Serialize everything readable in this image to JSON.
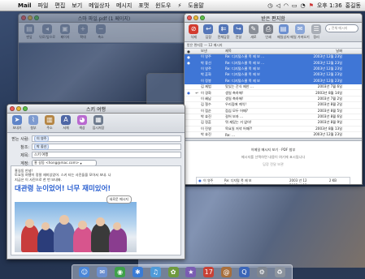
{
  "menubar": {
    "app_name": "Mail",
    "items": [
      "파일",
      "편집",
      "보기",
      "메일상자",
      "메시지",
      "포맷",
      "윈도우",
      "도움말"
    ],
    "status_icons": [
      "sync-icon",
      "volume-icon",
      "airport-icon",
      "battery-icon",
      "timer-icon",
      "flag-icon"
    ],
    "clock": "오후 1:36",
    "user": "홍길동"
  },
  "back_window": {
    "title": "스마 파일.pdf (1 페이지)",
    "toolbar": [
      "맨앞",
      "뒤로/앞으로",
      "페이지",
      "확대",
      "축소"
    ]
  },
  "mail_window": {
    "title": "받은 편지함",
    "toolbar": [
      {
        "label": "삭제",
        "icon": "delete-icon",
        "color": "#d23b2f"
      },
      {
        "label": "답장",
        "icon": "reply-icon",
        "color": "#5476b8"
      },
      {
        "label": "전체답장",
        "icon": "reply-all-icon",
        "color": "#5476b8"
      },
      {
        "label": "전달",
        "icon": "forward-icon",
        "color": "#5476b8"
      },
      {
        "label": "새로",
        "icon": "compose-icon",
        "color": "#8a8f98"
      },
      {
        "label": "인쇄",
        "icon": "print-icon",
        "color": "#7b808a"
      },
      {
        "label": "메일상자",
        "icon": "mailbox-icon",
        "color": "#6c8fcf"
      },
      {
        "label": "메일 가져오기",
        "icon": "get-mail-icon",
        "color": "#8aa6d8"
      },
      {
        "label": "정리",
        "icon": "smart-icon",
        "color": "#a9aeb6"
      }
    ],
    "search_placeholder": "전체 메시지",
    "search_scope": "메일상자 선택",
    "folderbar": "받은 편지함 — 12 메시지",
    "columns": {
      "from": "보낸",
      "subject": "제목",
      "date": "날짜"
    },
    "rows": [
      {
        "flag": "●",
        "icon": "",
        "from": "이 영주",
        "subject": "Re: 디지털스쿨 폭 제 보 ...",
        "date": "2003년 12월 23일",
        "selected": true
      },
      {
        "flag": "●",
        "icon": "",
        "from": "박 좋선",
        "subject": "Re: 디지털스쿨 폭 제 보 ...",
        "date": "2003년 12월 23일",
        "selected": true
      },
      {
        "flag": "",
        "icon": "",
        "from": "이 영주",
        "subject": "Re: 디지털스쿨 폭 제 보",
        "date": "2003년 12월 23일",
        "selected": true
      },
      {
        "flag": "",
        "icon": "",
        "from": "박 훈화",
        "subject": "Re: 디지털스쿨 폭 제 보",
        "date": "2003년 12월 23일",
        "selected": true
      },
      {
        "flag": "",
        "icon": "",
        "from": "이 정봉",
        "subject": "Re: 디지털스쿨 폭 제 보",
        "date": "2003년 12월 23일",
        "selected": true
      },
      {
        "flag": "",
        "icon": "",
        "from": "김 제법",
        "subject": "맛있는 간식 제안 ...",
        "date": "2003년 7월 6일",
        "selected": false
      },
      {
        "flag": "●",
        "icon": "↩",
        "from": "이 경화",
        "subject": "생일 축하해!",
        "date": "2003년 8월 14일",
        "selected": false
      },
      {
        "flag": "",
        "icon": "",
        "from": "이 혜남",
        "subject": "생일 축하해!",
        "date": "2003년 7월 2일",
        "selected": false
      },
      {
        "flag": "",
        "icon": "",
        "from": "김 철수",
        "subject": "우리집에 케익!",
        "date": "2003년 8월 2일",
        "selected": false
      },
      {
        "flag": "",
        "icon": "",
        "from": "이 점순",
        "subject": "점심 모두 어때?",
        "date": "2003년 8월 5일",
        "selected": false
      },
      {
        "flag": "",
        "icon": "",
        "from": "박 효진",
        "subject": "걸어 보자 ...",
        "date": "2003년 8월 6일",
        "selected": false
      },
      {
        "flag": "",
        "icon": "",
        "from": "김 정훈",
        "subject": "뭐 재밌는 거 없어!",
        "date": "2003년 8월 9일",
        "selected": false
      },
      {
        "flag": "",
        "icon": "",
        "from": "이 진영",
        "subject": "목요일 저녁 어때?!",
        "date": "2003년 8월 13일",
        "selected": false
      },
      {
        "flag": "",
        "icon": "",
        "from": "박 효진",
        "subject": "Re: ...",
        "date": "2003년 12월 23일",
        "selected": false
      }
    ],
    "preview": {
      "line1": "이메일 메시지 보기 · PDF 첨부",
      "line2": "메시지를 선택하면 내용이 여기에 표시됩니다",
      "line3": "답장 전달 보관"
    },
    "subrows": [
      {
        "dot": "●",
        "from": "이 영주",
        "subject": "Re: 디지털 폭 제 보",
        "date": "2003 년 12",
        "size": "2 KB"
      },
      {
        "dot": "",
        "from": "박 좋선",
        "subject": "Re: 디지털 폭 제 보",
        "date": "2003 년 12",
        "size": "3 KB"
      },
      {
        "dot": "",
        "from": "박 효진",
        "subject": "Re: 디지털 폭 제 보",
        "date": "2003 년 12",
        "size": "2 KB"
      }
    ]
  },
  "compose_window": {
    "title": "스키 여행",
    "toolbar": [
      {
        "label": "보내기",
        "icon": "send-icon",
        "color": "#5e84c8"
      },
      {
        "label": "첨부",
        "icon": "attach-icon",
        "color": "#7e9bd0"
      },
      {
        "label": "주소",
        "icon": "address-icon",
        "color": "#b58645"
      },
      {
        "label": "서체",
        "icon": "fonts-icon",
        "color": "#4e66a5"
      },
      {
        "label": "색상",
        "icon": "colors-icon",
        "color": "#b96ad0"
      },
      {
        "label": "임시저장",
        "icon": "draft-icon",
        "color": "#6e7b8e"
      }
    ],
    "fields": {
      "to_label": "받는 사람:",
      "to_value": "이 영주",
      "cc_label": "참조:",
      "cc_value": "박 좋선",
      "subject_label": "제목:",
      "subject_value": "스키 여행",
      "account_label": "계정:",
      "account_value": "홍 길동 <hong@mac.com>"
    },
    "body_lines": [
      "홍길동 안녕!",
      "토요일 여행이 정말 재미있었어. 스키 타는 사진들을 모아서 보내. 나",
      "지금은 이 사진으로 한 번 보내봐."
    ],
    "headline": "대관령 눈이었어! 너무 재미있어!",
    "bubble": "새로운 메시지"
  },
  "dock": [
    {
      "name": "finder-icon",
      "glyph": "☺",
      "color": "#4a86d8"
    },
    {
      "name": "mail-icon",
      "glyph": "✉",
      "color": "#6c8fcf"
    },
    {
      "name": "ichat-icon",
      "glyph": "◉",
      "color": "#3fa04a"
    },
    {
      "name": "safari-icon",
      "glyph": "✱",
      "color": "#3a7bd5"
    },
    {
      "name": "itunes-icon",
      "glyph": "♫",
      "color": "#4f9bd9"
    },
    {
      "name": "iphoto-icon",
      "glyph": "✿",
      "color": "#6f9a3e"
    },
    {
      "name": "imovie-icon",
      "glyph": "★",
      "color": "#7a5cb2"
    },
    {
      "name": "ical-icon",
      "glyph": "17",
      "color": "#c94136"
    },
    {
      "name": "addressbook-icon",
      "glyph": "@",
      "color": "#a86f3c"
    },
    {
      "name": "quicktime-icon",
      "glyph": "Q",
      "color": "#3b66b8"
    },
    {
      "name": "sysprefs-icon",
      "glyph": "⚙",
      "color": "#7f8690"
    },
    {
      "name": "trash-icon",
      "glyph": "♻",
      "color": "#8d949e"
    }
  ]
}
